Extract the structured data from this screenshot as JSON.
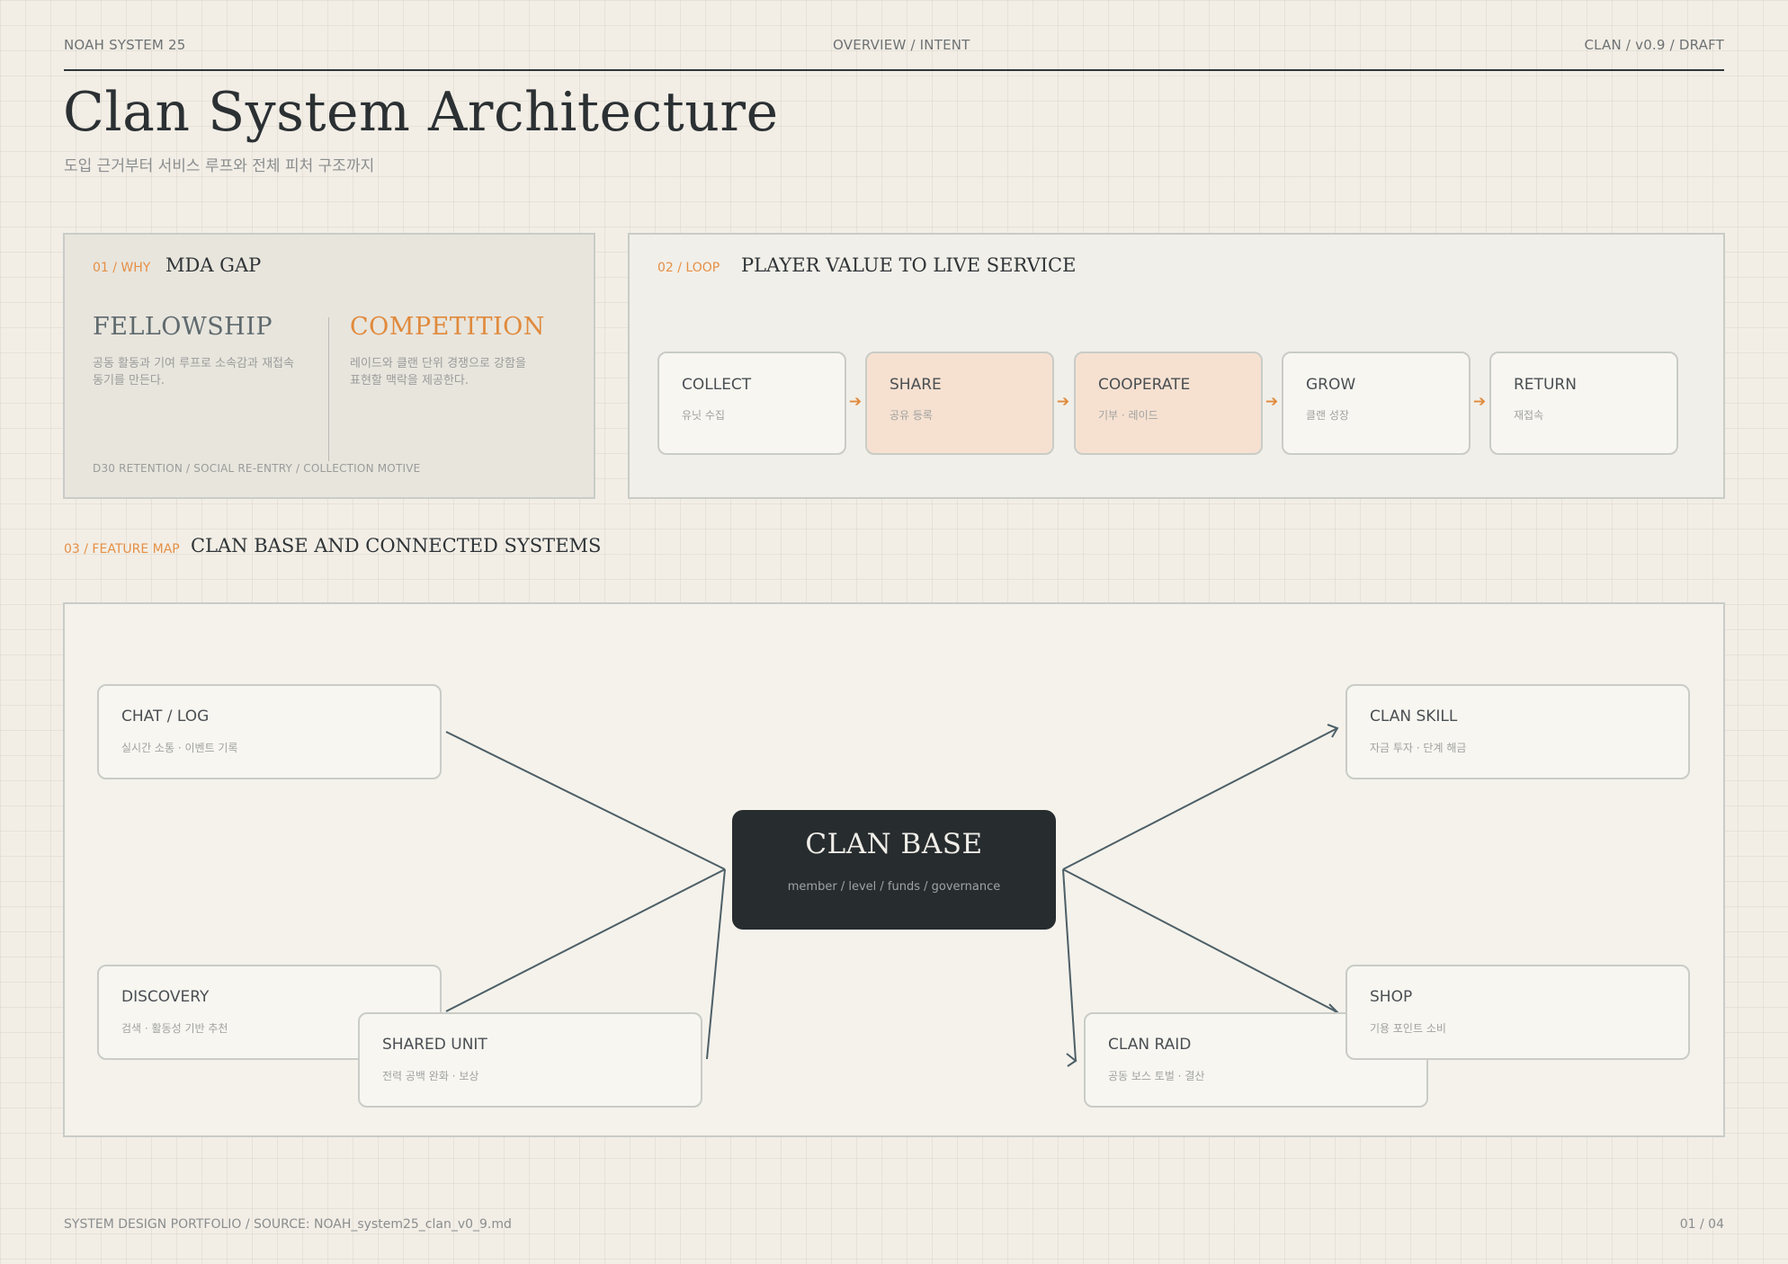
{
  "header": {
    "left": "NOAH SYSTEM 25",
    "center": "OVERVIEW / INTENT",
    "right": "CLAN / v0.9 / DRAFT"
  },
  "title": "Clan System Architecture",
  "subtitle": "도입 근거부터 서비스 루프와 전체 피처 구조까지",
  "why": {
    "label": "01 / WHY",
    "title": "MDA GAP",
    "fellowship": {
      "title": "FELLOWSHIP",
      "line1": "공동 활동과 기여 루프로 소속감과 재접속",
      "line2": "동기를 만든다."
    },
    "competition": {
      "title": "COMPETITION",
      "line1": "레이드와 클랜 단위 경쟁으로 강함을",
      "line2": "표현할 맥락을 제공한다."
    },
    "footnote": "D30 RETENTION / SOCIAL RE-ENTRY / COLLECTION MOTIVE",
    "colors": {
      "fellowship": "#5f6a6e",
      "competition": "#e08a3c"
    }
  },
  "loop": {
    "label": "02 / LOOP",
    "title": "PLAYER VALUE TO LIVE SERVICE",
    "steps": [
      {
        "name": "COLLECT",
        "sub": "유닛 수집",
        "highlight": false
      },
      {
        "name": "SHARE",
        "sub": "공유 등록",
        "highlight": true
      },
      {
        "name": "COOPERATE",
        "sub": "기부 · 레이드",
        "highlight": true
      },
      {
        "name": "GROW",
        "sub": "클랜 성장",
        "highlight": false
      },
      {
        "name": "RETURN",
        "sub": "재접속",
        "highlight": false
      }
    ],
    "arrow_icon": "arrow-right-icon"
  },
  "feature_map": {
    "label": "03 / FEATURE MAP",
    "title": "CLAN BASE AND CONNECTED SYSTEMS",
    "center": {
      "title": "CLAN BASE",
      "sub": "member / level / funds / governance"
    },
    "nodes": {
      "chat": {
        "name": "CHAT / LOG",
        "sub": "실시간 소통 · 이벤트 기록"
      },
      "discovery": {
        "name": "DISCOVERY",
        "sub": "검색 · 활동성 기반 추천"
      },
      "shared_unit": {
        "name": "SHARED UNIT",
        "sub": "전력 공백 완화 · 보상"
      },
      "clan_skill": {
        "name": "CLAN SKILL",
        "sub": "자금 투자 · 단계 해금"
      },
      "shop": {
        "name": "SHOP",
        "sub": "기용 포인트 소비"
      },
      "clan_raid": {
        "name": "CLAN RAID",
        "sub": "공동 보스 토벌 · 결산"
      }
    },
    "connector_color": "#4d5f67"
  },
  "footer": {
    "left": "SYSTEM DESIGN PORTFOLIO / SOURCE: NOAH_system25_clan_v0_9.md",
    "right": "01 / 04"
  }
}
